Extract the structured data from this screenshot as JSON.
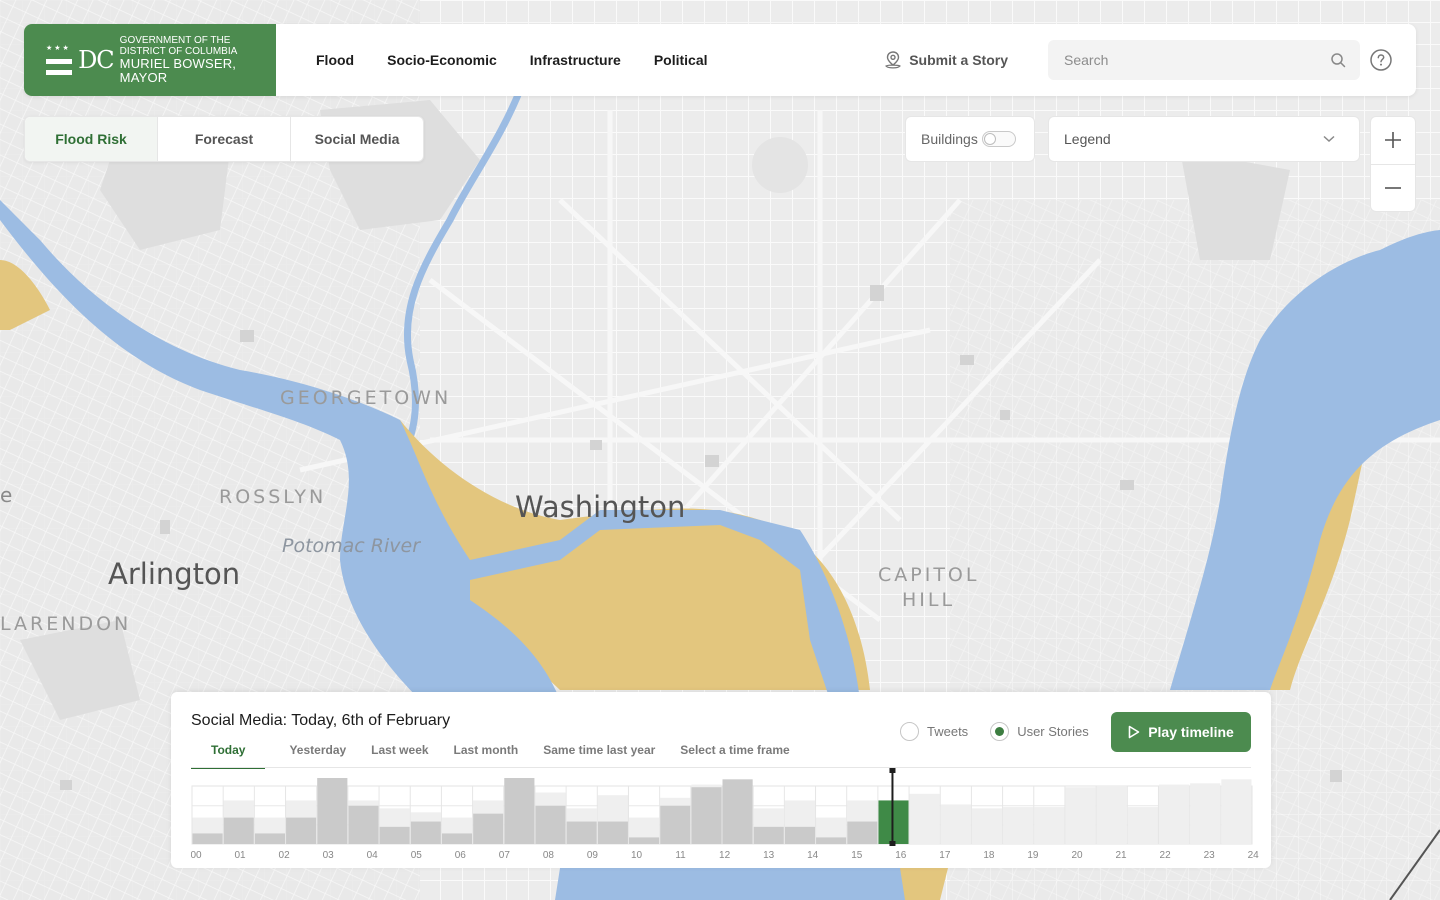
{
  "header": {
    "logo": {
      "initials": "DC",
      "line1": "GOVERNMENT OF THE",
      "line2": "DISTRICT OF COLUMBIA",
      "line3": "MURIEL BOWSER, MAYOR"
    },
    "nav": [
      "Flood",
      "Socio-Economic",
      "Infrastructure",
      "Political"
    ],
    "submit_story": "Submit a Story",
    "search_placeholder": "Search"
  },
  "view_tabs": [
    {
      "label": "Flood Risk",
      "active": true
    },
    {
      "label": "Forecast",
      "active": false
    },
    {
      "label": "Social Media",
      "active": false
    }
  ],
  "buildings": {
    "label": "Buildings",
    "on": false
  },
  "legend": {
    "label": "Legend"
  },
  "map_labels": {
    "georgetown": "GEORGETOWN",
    "rosslyn": "ROSSLYN",
    "potomac": "Potomac River",
    "washington": "Washington",
    "capitol1": "CAPITOL",
    "capitol2": "HILL",
    "arlington": "Arlington",
    "clarendon": "LARENDON",
    "left_edge": "e"
  },
  "colors": {
    "brand_green": "#4c8b4f",
    "flood_blue": "#9cbce3",
    "flood_sand": "#e3c67e",
    "bar_gray": "#cacaca",
    "bar_light": "#efefef",
    "bar_active": "#3f8a47"
  },
  "panel": {
    "title": "Social Media: Today, 6th of February",
    "time_tabs": [
      {
        "label": "Today",
        "active": true
      },
      {
        "label": "Yesterday",
        "active": false
      },
      {
        "label": "Last week",
        "active": false
      },
      {
        "label": "Last month",
        "active": false
      },
      {
        "label": "Same time last year",
        "active": false
      },
      {
        "label": "Select a time frame",
        "active": false
      }
    ],
    "radios": [
      {
        "label": "Tweets",
        "checked": false
      },
      {
        "label": "User Stories",
        "checked": true
      }
    ],
    "play_label": "Play timeline"
  },
  "chart_data": {
    "type": "bar",
    "categories": [
      "00",
      "01",
      "02",
      "03",
      "04",
      "05",
      "06",
      "07",
      "08",
      "09",
      "10",
      "11",
      "12",
      "13",
      "14",
      "15",
      "16",
      "17",
      "18",
      "19",
      "20",
      "21",
      "22",
      "23",
      "24"
    ],
    "series": [
      {
        "values": [
          0.16,
          0.4,
          0.16,
          0.4,
          1.0,
          0.58,
          0.26,
          0.34,
          0.16,
          0.46,
          1.0,
          0.58,
          0.34,
          0.34,
          0.1,
          0.58,
          0.86,
          0.98,
          0.26,
          0.26,
          0.1,
          0.34,
          0.66,
          null,
          null,
          null,
          null,
          null,
          null,
          null,
          null,
          null,
          null,
          null
        ]
      },
      {
        "values": [
          0.4,
          0.66,
          0.4,
          0.66,
          null,
          0.66,
          0.54,
          0.48,
          0.4,
          0.66,
          null,
          0.78,
          0.54,
          0.74,
          0.4,
          0.7,
          0.9,
          null,
          0.54,
          0.66,
          0.4,
          0.66,
          0.66,
          0.76,
          0.6,
          0.54,
          0.56,
          0.56,
          0.86,
          0.88,
          0.56,
          0.9,
          0.92,
          0.98
        ]
      }
    ],
    "current_index": 22,
    "ylim": [
      0,
      1
    ]
  }
}
